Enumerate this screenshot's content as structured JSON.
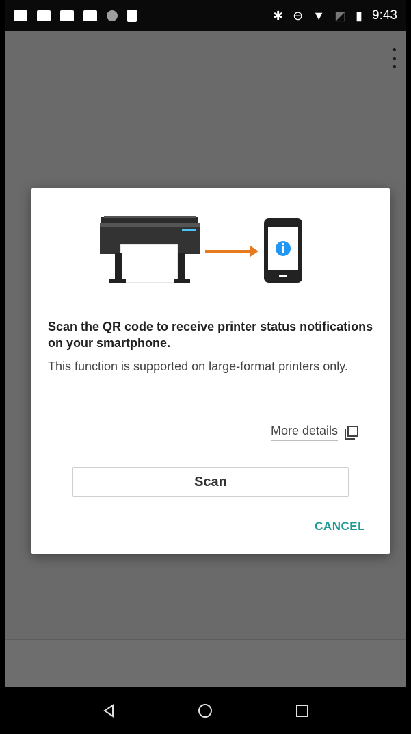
{
  "status_bar": {
    "time": "9:43",
    "left_icons": [
      "cloud-icon",
      "cast-icon",
      "image-icon",
      "youtube-icon",
      "circle-icon",
      "download-icon"
    ],
    "right_icons": [
      "bluetooth-icon",
      "dnd-icon",
      "wifi-icon",
      "no-sim-icon",
      "battery-icon"
    ]
  },
  "dialog": {
    "title": "Scan the QR code to receive printer status notifications on your smartphone.",
    "body": "This function is supported on large-format printers only.",
    "more_details_label": "More details",
    "scan_label": "Scan",
    "cancel_label": "CANCEL"
  },
  "colors": {
    "accent": "#1d9a91",
    "arrow": "#e87a1e",
    "info_blue": "#2196f3",
    "printer_accent": "#4fc3f7"
  },
  "nav": {
    "icons": [
      "back-icon",
      "home-icon",
      "recents-icon"
    ]
  }
}
